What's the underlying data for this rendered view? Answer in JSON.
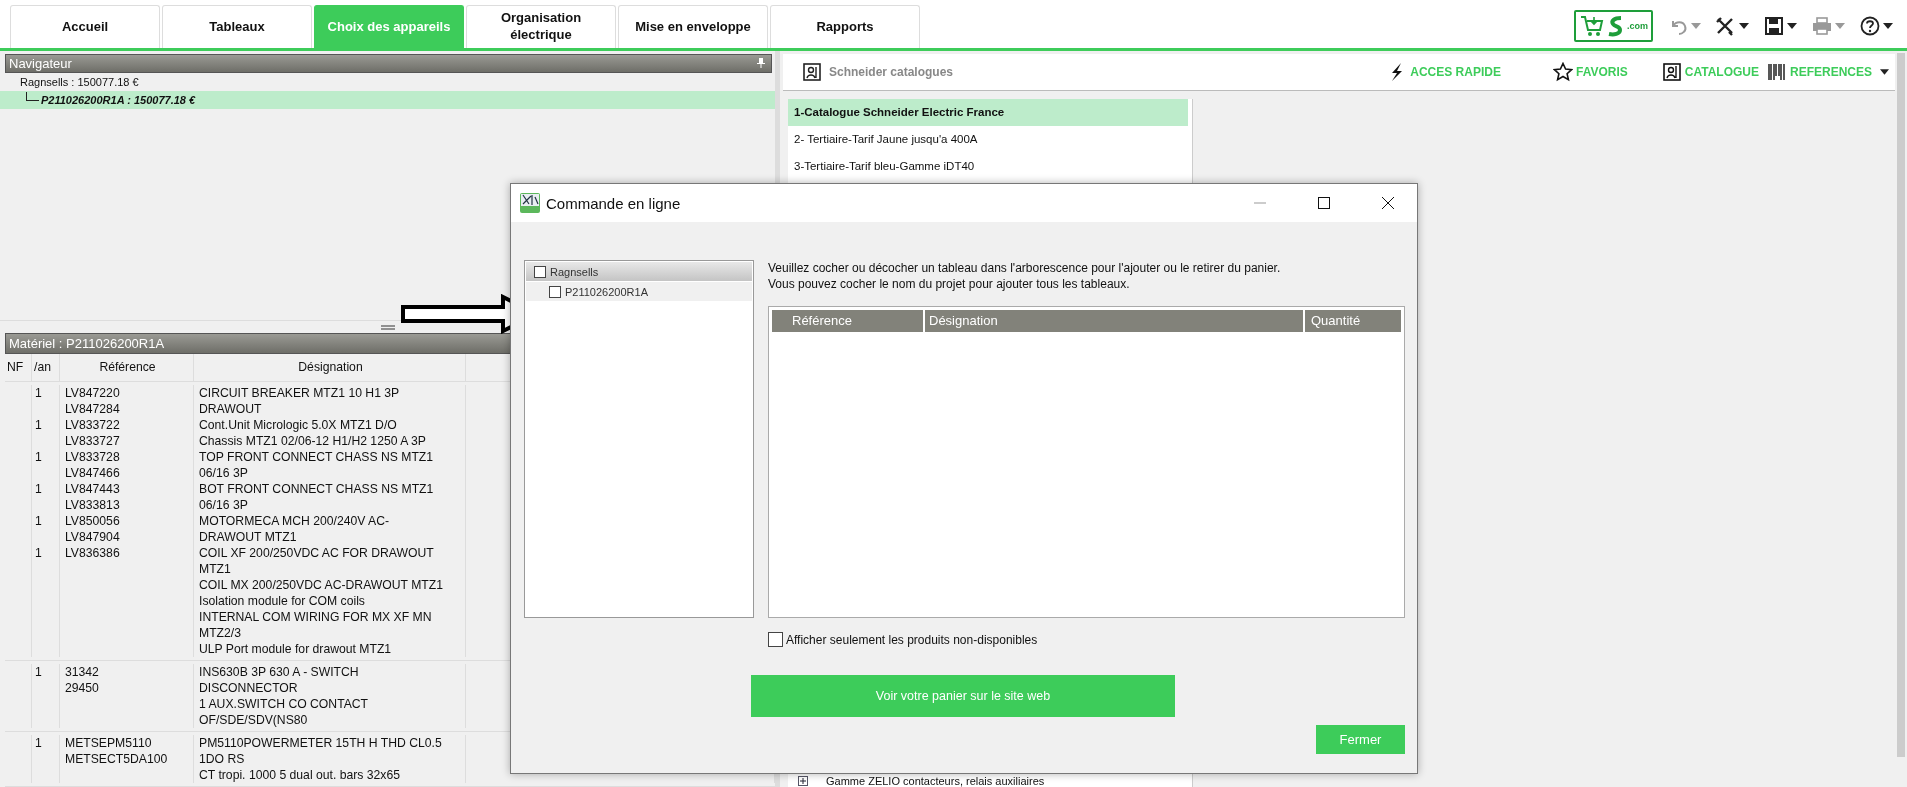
{
  "tabs": [
    {
      "label": "Accueil",
      "selected": false
    },
    {
      "label": "Tableaux",
      "selected": false
    },
    {
      "label": "Choix des appareils",
      "selected": true
    },
    {
      "label": "Organisation électrique",
      "selected": false
    },
    {
      "label": "Mise en enveloppe",
      "selected": false
    },
    {
      "label": "Rapports",
      "selected": false
    }
  ],
  "logo": {
    "text": ".com"
  },
  "toolbar_icons": [
    {
      "kind": "undo",
      "disabled": true
    },
    {
      "kind": "tools",
      "disabled": false
    },
    {
      "kind": "save",
      "disabled": false
    },
    {
      "kind": "print",
      "disabled": true
    },
    {
      "kind": "help",
      "disabled": false
    }
  ],
  "navigator": {
    "title": "Navigateur",
    "tree": [
      {
        "label": "Ragnsells : 150077.18 €",
        "selected": false,
        "children": [
          {
            "label": "P211026200R1A : 150077.18 €",
            "selected": true
          }
        ]
      }
    ]
  },
  "material": {
    "title": "Matériel : P211026200R1A",
    "columns": [
      "NF",
      "/an",
      "Référence",
      "Désignation"
    ],
    "groups": [
      {
        "lines": [
          {
            "qty": "1",
            "ref": "LV847220",
            "des": "CIRCUIT BREAKER MTZ1 10 H1 3P"
          },
          {
            "ref": "LV847284",
            "des": "DRAWOUT"
          },
          {
            "qty": "1",
            "ref": "LV833722",
            "des": "Cont.Unit Micrologic 5.0X MTZ1 D/O"
          },
          {
            "ref": "LV833727",
            "des": "Chassis MTZ1 02/06-12 H1/H2 1250 A 3P"
          },
          {
            "qty": "1",
            "ref": "LV833728",
            "des": "TOP FRONT CONNECT CHASS NS MTZ1"
          },
          {
            "ref": "LV847466",
            "des": "06/16 3P"
          },
          {
            "qty": "1",
            "ref": "LV847443",
            "des": "BOT FRONT CONNECT CHASS NS MTZ1"
          },
          {
            "ref": "LV833813",
            "des": "06/16 3P"
          },
          {
            "qty": "1",
            "ref": "LV850056",
            "des": "MOTORMECA MCH 200/240V AC-"
          },
          {
            "ref": "LV847904",
            "des": "DRAWOUT MTZ1"
          },
          {
            "qty": "1",
            "ref": "LV836386",
            "des": "COIL XF 200/250VDC AC FOR DRAWOUT"
          },
          {
            "des": "MTZ1"
          },
          {
            "des": "COIL MX 200/250VDC AC-DRAWOUT MTZ1"
          },
          {
            "des": "Isolation module for COM coils"
          },
          {
            "des": "INTERNAL COM WIRING FOR MX XF MN"
          },
          {
            "des": "MTZ2/3"
          },
          {
            "des": "ULP Port module for drawout MTZ1"
          }
        ]
      },
      {
        "lines": [
          {
            "qty": "1",
            "ref": "31342",
            "des": "INS630B 3P 630 A - SWITCH"
          },
          {
            "ref": "29450",
            "des": "DISCONNECTOR"
          },
          {
            "des": "1 AUX.SWITCH CO CONTACT"
          },
          {
            "des": "OF/SDE/SDV(NS80"
          }
        ]
      },
      {
        "lines": [
          {
            "qty": "1",
            "ref": "METSEPM5110",
            "des": "PM5110POWERMETER 15TH H THD CL0.5"
          },
          {
            "ref": "METSECT5DA100",
            "des": "1DO RS"
          },
          {
            "des": "CT tropi. 1000 5 dual out. bars 32x65"
          }
        ]
      }
    ]
  },
  "catalog_toolbar": {
    "title": "Schneider catalogues",
    "actions": [
      {
        "kind": "bolt",
        "label": "ACCES RAPIDE"
      },
      {
        "kind": "star",
        "label": "FAVORIS"
      },
      {
        "kind": "book",
        "label": "CATALOGUE"
      },
      {
        "kind": "barcode",
        "label": "REFERENCES"
      }
    ]
  },
  "catalogs": [
    {
      "label": "1-Catalogue Schneider Electric France",
      "selected": true
    },
    {
      "label": "2- Tertiaire-Tarif Jaune jusqu'a 400A",
      "selected": false
    },
    {
      "label": "3-Tertiaire-Tarif bleu-Gamme iDT40",
      "selected": false
    }
  ],
  "catalog_tree_item": "Gamme ZELIO contacteurs, relais auxiliaires",
  "dialog": {
    "title": "Commande en ligne",
    "tree": [
      {
        "label": "Ragnsells",
        "checked": false,
        "children": [
          {
            "label": "P211026200R1A",
            "checked": false
          }
        ]
      }
    ],
    "instructions": [
      "Veuillez cocher ou décocher un tableau dans l'arborescence pour l'ajouter ou le retirer du panier.",
      "Vous pouvez cocher le nom du projet pour ajouter tous les tableaux."
    ],
    "columns": [
      "Référence",
      "Désignation",
      "Quantité"
    ],
    "filter": {
      "label": "Afficher seulement les produits non-disponibles",
      "checked": false
    },
    "web_button": "Voir votre panier sur le site web",
    "close_button": "Fermer"
  }
}
